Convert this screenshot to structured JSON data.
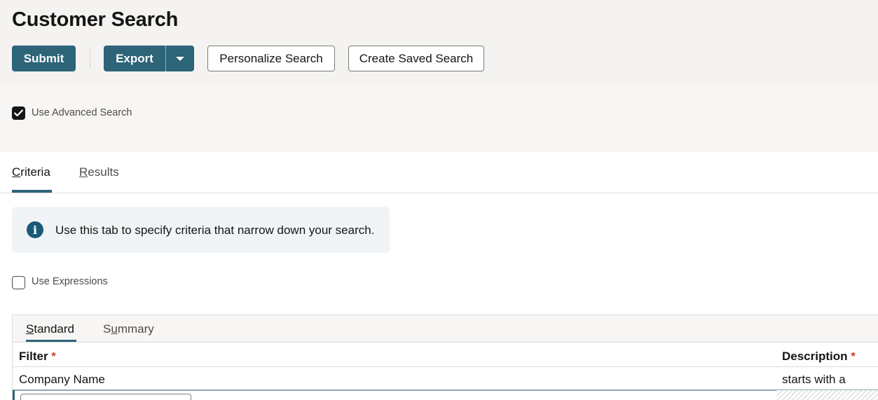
{
  "page": {
    "title": "Customer Search"
  },
  "toolbar": {
    "submit_label": "Submit",
    "export_label": "Export",
    "personalize_label": "Personalize Search",
    "create_saved_label": "Create Saved Search"
  },
  "advanced": {
    "label": "Use Advanced Search",
    "checked": true
  },
  "tabs": [
    {
      "first": "C",
      "rest": "riteria",
      "active": true
    },
    {
      "first": "R",
      "rest": "esults",
      "active": false
    }
  ],
  "info": {
    "icon": "info-icon",
    "glyph": "i",
    "text": "Use this tab to specify criteria that narrow down your search."
  },
  "expressions": {
    "label": "Use Expressions",
    "checked": false
  },
  "subtabs": [
    {
      "pre": "",
      "u": "S",
      "post": "tandard",
      "active": true
    },
    {
      "pre": "S",
      "u": "u",
      "post": "mmary",
      "active": false
    }
  ],
  "grid": {
    "columns": [
      {
        "label": "Filter",
        "required_mark": "*"
      },
      {
        "label": "Description",
        "required_mark": "*"
      }
    ],
    "rows": [
      {
        "filter": "Company Name",
        "description": "starts with a"
      }
    ]
  },
  "colors": {
    "primary": "#2d6478",
    "required": "#c74634",
    "info": "#1b5a79"
  }
}
